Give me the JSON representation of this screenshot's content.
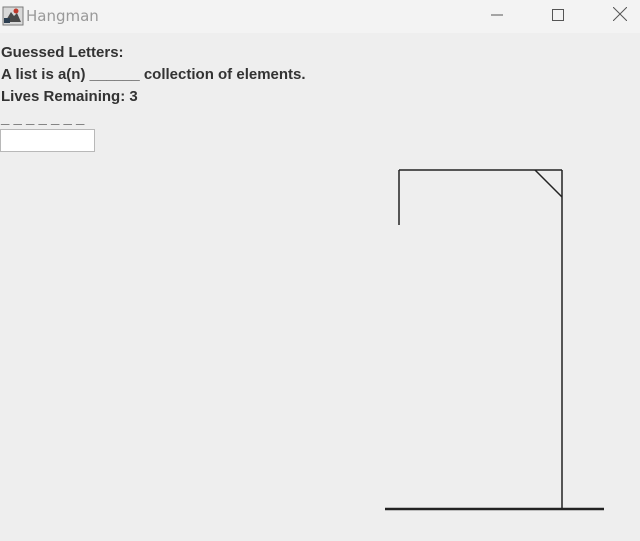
{
  "window": {
    "title": "Hangman"
  },
  "game": {
    "guessed_letters_label": "Guessed Letters:",
    "question": "A list is a(n) ______ collection of elements.",
    "lives_label": "Lives Remaining: 3",
    "word_blanks": "_ _ _ _ _ _ _",
    "guess_input_value": ""
  },
  "icons": {
    "app": "hangman-app-icon",
    "minimize": "minimize-icon",
    "maximize": "maximize-icon",
    "close": "close-icon"
  }
}
